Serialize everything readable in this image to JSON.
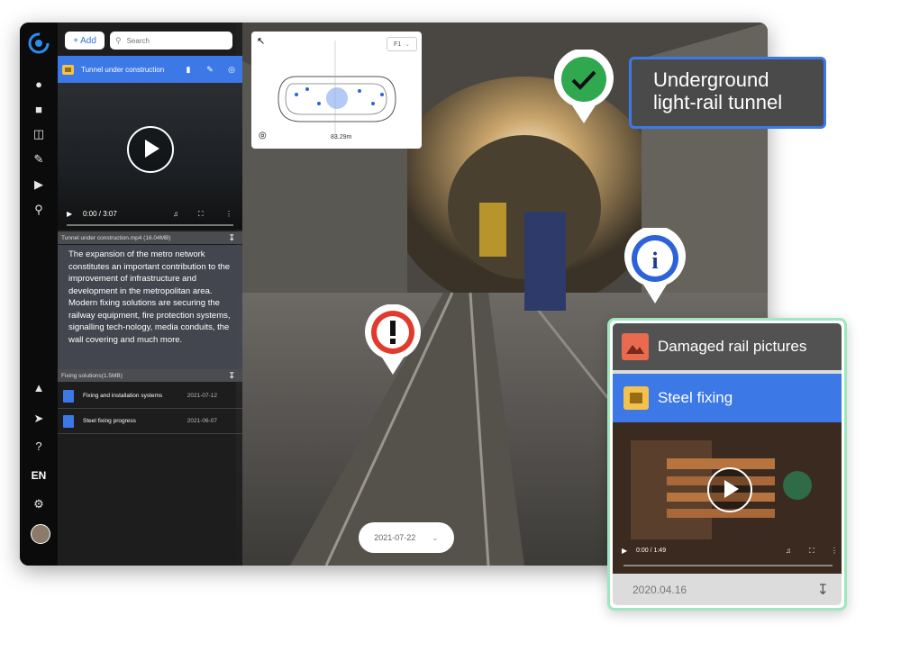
{
  "panel": {
    "add_label": "+ Add",
    "search_placeholder": "Search",
    "active_item": "Tunnel under construction",
    "video_time": "0:00 / 3:07",
    "video_file": "Tunnel under construction.mp4 (16.04MB)",
    "description": "The expansion of the metro network constitutes an important contribution to the improvement of infrastructure and development in the metropolitan area. Modern fixing solutions are securing the railway equipment, fire protection systems, signalling tech-nology, media conduits, the wall covering and much more.",
    "attachment_file": "Fixing solutions(1.5MB)",
    "sub_items": [
      {
        "label": "Fixing and installation systems",
        "date": "2021-07-12"
      },
      {
        "label": "Steel fixing progress",
        "date": "2021-06-07"
      }
    ]
  },
  "nav": {
    "language": "EN"
  },
  "minimap": {
    "floor": "F1",
    "scale": "83.29m"
  },
  "scene": {
    "date": "2021-07-22"
  },
  "callout": {
    "line1": "Underground",
    "line2": "light-rail tunnel"
  },
  "card": {
    "row1_title": "Damaged rail pictures",
    "row2_title": "Steel fixing",
    "video_time": "0:00 / 1:49",
    "date": "2020.04.16"
  },
  "colors": {
    "accent": "#3c78e6",
    "success": "#2fa84f",
    "danger": "#e23b2e",
    "card_border": "#9fe7bf"
  }
}
